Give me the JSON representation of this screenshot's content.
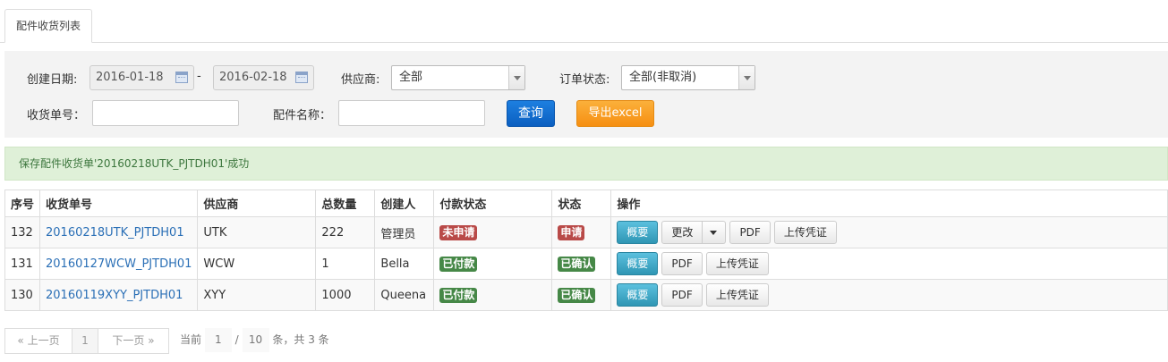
{
  "tab": {
    "label": "配件收货列表"
  },
  "filters": {
    "created_date_label": "创建日期:",
    "date_from": "2016-01-18",
    "date_separator": "-",
    "date_to": "2016-02-18",
    "supplier_label": "供应商:",
    "supplier_value": "全部",
    "order_status_label": "订单状态:",
    "order_status_value": "全部(非取消)",
    "receipt_no_label": "收货单号：",
    "receipt_no_value": "",
    "part_name_label": "配件名称：",
    "part_name_value": "",
    "search_button": "查询",
    "export_button": "导出excel"
  },
  "alert": {
    "message": "保存配件收货单'20160218UTK_PJTDH01'成功"
  },
  "table": {
    "headers": [
      "序号",
      "收货单号",
      "供应商",
      "总数量",
      "创建人",
      "付款状态",
      "状态",
      "操作"
    ],
    "rows": [
      {
        "seq": "132",
        "receipt_no": "20160218UTK_PJTDH01",
        "supplier": "UTK",
        "qty": "222",
        "creator": "管理员",
        "pay_status": "未申请",
        "status": "申请",
        "pay_color": "red",
        "status_color": "red"
      },
      {
        "seq": "131",
        "receipt_no": "20160127WCW_PJTDH01",
        "supplier": "WCW",
        "qty": "1",
        "creator": "Bella",
        "pay_status": "已付款",
        "status": "已确认",
        "pay_color": "green",
        "status_color": "green"
      },
      {
        "seq": "130",
        "receipt_no": "20160119XYY_PJTDH01",
        "supplier": "XYY",
        "qty": "1000",
        "creator": "Queena",
        "pay_status": "已付款",
        "status": "已确认",
        "pay_color": "green",
        "status_color": "green"
      }
    ],
    "actions": {
      "summary": "概要",
      "edit": "更改",
      "pdf": "PDF",
      "upload": "上传凭证"
    }
  },
  "pager": {
    "prev": "« 上一页",
    "current_page_btn": "1",
    "next": "下一页 »",
    "info_prefix": "当前",
    "page": "1",
    "slash": "/",
    "total_pages": "10",
    "info_suffix": "条，共 3 条"
  }
}
